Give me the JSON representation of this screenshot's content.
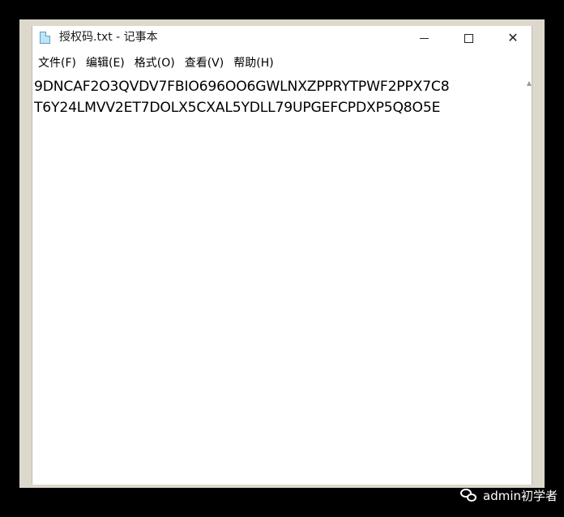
{
  "window": {
    "title": "授权码.txt - 记事本",
    "minimize_symbol": "",
    "close_symbol": "✕"
  },
  "menu": {
    "items": [
      {
        "label": "文件(F)"
      },
      {
        "label": "编辑(E)"
      },
      {
        "label": "格式(O)"
      },
      {
        "label": "查看(V)"
      },
      {
        "label": "帮助(H)"
      }
    ]
  },
  "document": {
    "lines": [
      "9DNCAF2O3QVDV7FBIO696OO6GWLNXZPPRYTPWF2PPX7C8",
      "T6Y24LMVV2ET7DOLX5CXAL5YDLL79UPGEFCPDXP5Q8O5E"
    ]
  },
  "scrollbar": {
    "arrow_icon": "up-arrow-icon",
    "arrow_glyph": "▲"
  },
  "watermark": {
    "text": "admin初学者",
    "icon": "wechat-icon"
  },
  "colors": {
    "outer_background": "#000000",
    "frame": "#ddd8cc",
    "editor_background": "#ffffff",
    "text": "#000000"
  }
}
